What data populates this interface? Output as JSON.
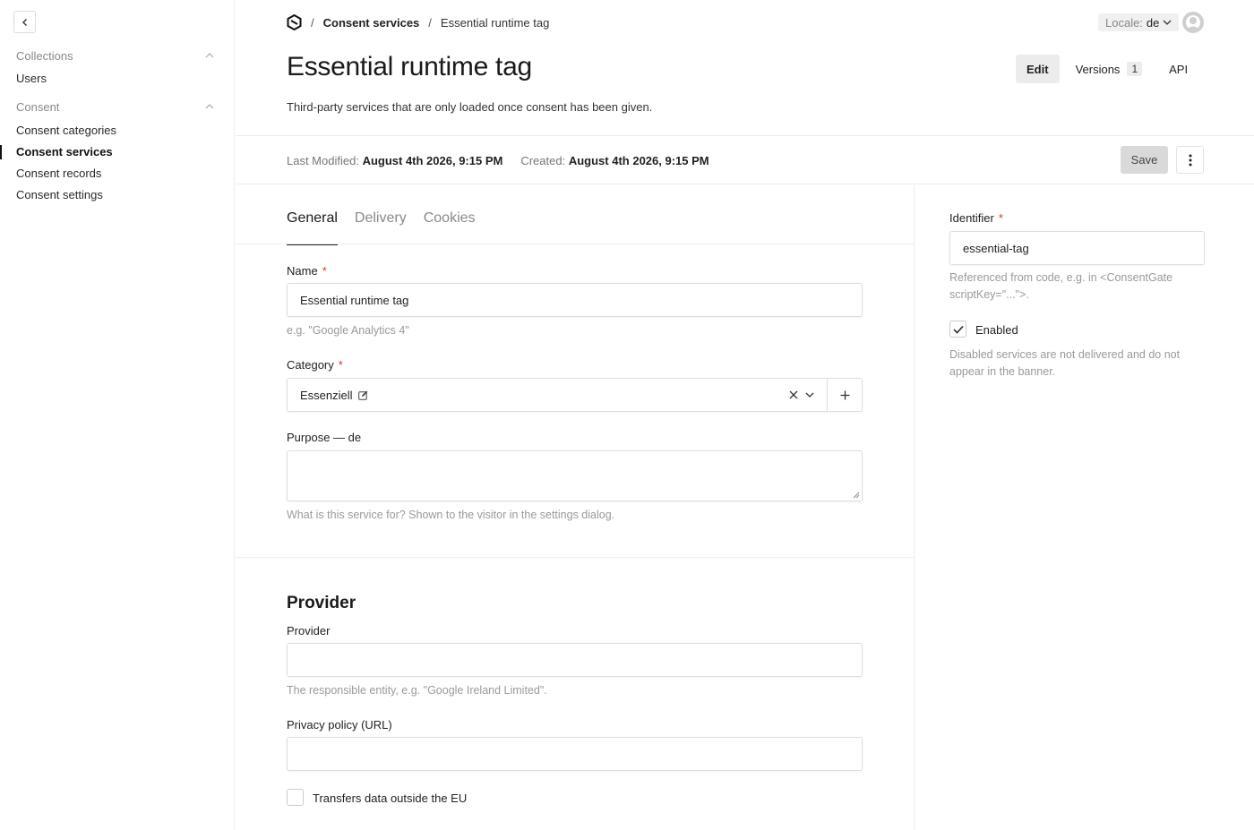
{
  "sidebar": {
    "groups": [
      {
        "label": "Collections",
        "items": [
          "Users"
        ]
      },
      {
        "label": "Consent",
        "items": [
          "Consent categories",
          "Consent services",
          "Consent records",
          "Consent settings"
        ]
      }
    ]
  },
  "header": {
    "breadcrumb": [
      "Consent services",
      "Essential runtime tag"
    ],
    "locale_label": "Locale:",
    "locale_value": "de",
    "title": "Essential runtime tag",
    "description": "Third-party services that are only loaded once consent has been given.",
    "actions": {
      "edit": "Edit",
      "versions": "Versions",
      "versions_count": "1",
      "api": "API"
    }
  },
  "meta": {
    "modified_label": "Last Modified:",
    "modified_value": "August 4th 2026, 9:15 PM",
    "created_label": "Created:",
    "created_value": "August 4th 2026, 9:15 PM",
    "save": "Save"
  },
  "tabs": [
    "General",
    "Delivery",
    "Cookies"
  ],
  "form": {
    "name_label": "Name",
    "name_value": "Essential runtime tag",
    "name_hint": "e.g. \"Google Analytics 4\"",
    "category_label": "Category",
    "category_value": "Essenziell",
    "purpose_label": "Purpose — de",
    "purpose_value": "",
    "purpose_hint": "What is this service for? Shown to the visitor in the settings dialog.",
    "provider_section": "Provider",
    "provider_label": "Provider",
    "provider_value": "",
    "provider_hint": "The responsible entity, e.g. \"Google Ireland Limited\".",
    "privacy_label": "Privacy policy (URL)",
    "privacy_value": "",
    "transfer_label": "Transfers data outside the EU"
  },
  "side": {
    "identifier_label": "Identifier",
    "identifier_value": "essential-tag",
    "identifier_hint": "Referenced from code, e.g. in <ConsentGate scriptKey=\"...\">.",
    "enabled_label": "Enabled",
    "enabled_checked": true,
    "enabled_hint": "Disabled services are not delivered and do not appear in the banner."
  },
  "icons": {
    "back": "chevron-left-icon",
    "logo": "logo-icon",
    "clear": "x-icon",
    "dropdown": "chevron-down-icon",
    "add": "plus-icon",
    "more": "more-vertical-icon",
    "edit": "edit-icon"
  }
}
